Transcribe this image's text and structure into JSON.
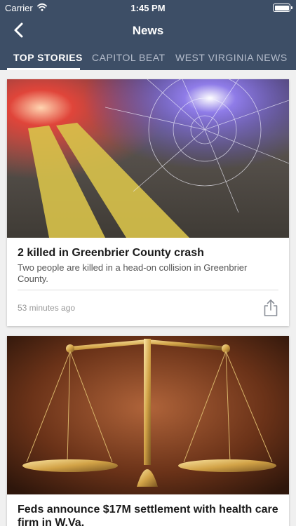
{
  "status_bar": {
    "carrier": "Carrier",
    "time": "1:45 PM"
  },
  "nav": {
    "title": "News",
    "back_icon": "chevron-left-icon"
  },
  "tabs": [
    {
      "label": "TOP STORIES",
      "active": true
    },
    {
      "label": "CAPITOL BEAT",
      "active": false
    },
    {
      "label": "WEST VIRGINIA NEWS",
      "active": false
    }
  ],
  "articles": [
    {
      "title": "2 killed in Greenbrier County crash",
      "summary": "Two people are killed in a head-on collision in Greenbrier County.",
      "timestamp": "53 minutes ago",
      "image": "crash-scene-shattered-glass-road"
    },
    {
      "title": "Feds announce $17M settlement with health care firm in W.Va.",
      "image": "scales-of-justice"
    }
  ],
  "colors": {
    "header": "#3d4e66",
    "background": "#f0f0f0",
    "inactive_tab": "#b4bccb"
  }
}
